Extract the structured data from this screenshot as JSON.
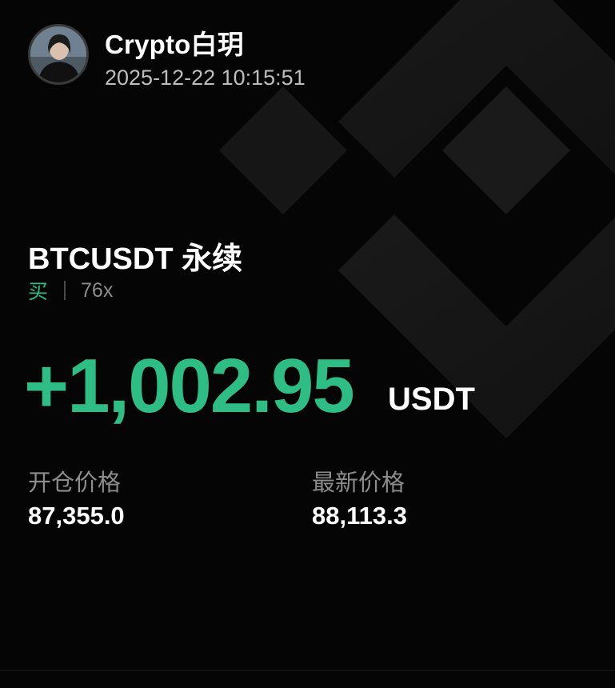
{
  "header": {
    "username": "Crypto白玥",
    "timestamp": "2025-12-22 10:15:51"
  },
  "position": {
    "symbol": "BTCUSDT 永续",
    "side": "买",
    "leverage": "76x"
  },
  "pnl": {
    "value": "+1,002.95",
    "unit": "USDT"
  },
  "prices": {
    "entry_label": "开仓价格",
    "entry_value": "87,355.0",
    "latest_label": "最新价格",
    "latest_value": "88,113.3"
  },
  "icons": {
    "background_logo": "binance-logo",
    "avatar": "user-avatar"
  },
  "colors": {
    "background": "#050505",
    "profit_green": "#2ebd85",
    "text_primary": "#ffffff",
    "text_secondary": "#8c8c8c",
    "logo_shape": "#161616"
  }
}
